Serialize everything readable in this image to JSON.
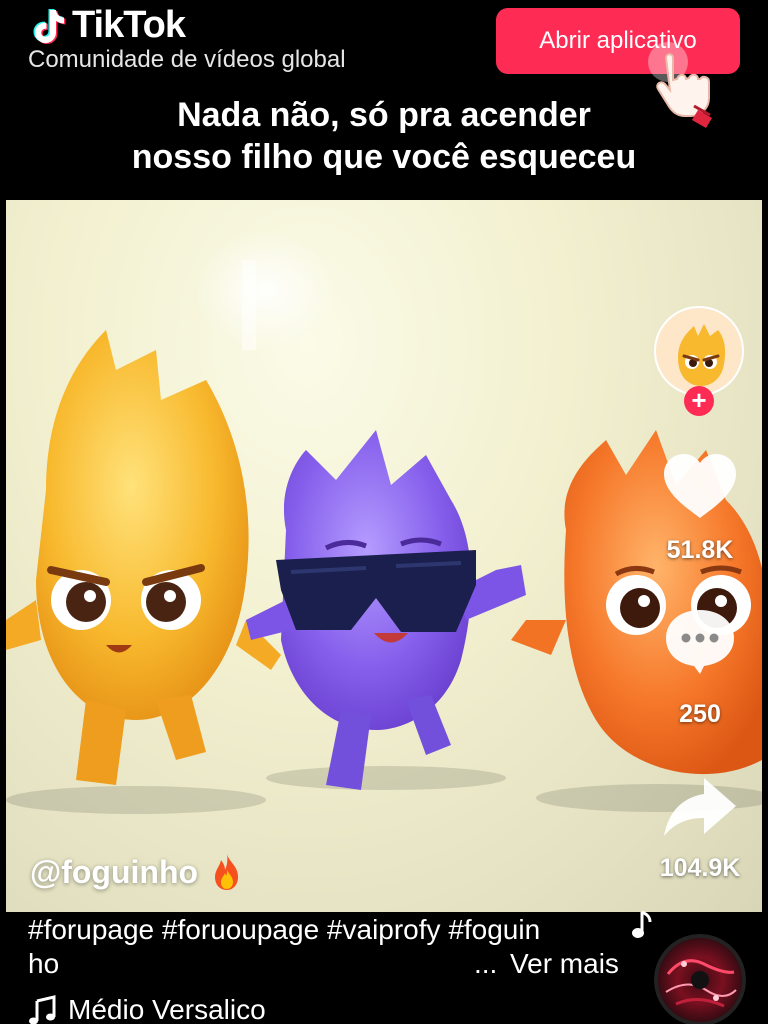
{
  "header": {
    "brand": "TikTok",
    "tagline": "Comunidade de vídeos global",
    "open_app_label": "Abrir aplicativo",
    "caption_line1": "Nada não, só pra acender",
    "caption_line2": "nosso filho que você esqueceu"
  },
  "rail": {
    "follow_symbol": "+",
    "likes": "51.8K",
    "comments": "250",
    "shares": "104.9K"
  },
  "post": {
    "username": "@foguinho",
    "description_line1": "#forupage #foruoupage #vaiprofy #foguin",
    "description_line2": "ho",
    "ellipsis": "...",
    "see_more": "Ver mais",
    "music": "Médio Versalico"
  },
  "colors": {
    "accent": "#fe2c55",
    "background": "#000000"
  },
  "icons": [
    "tiktok-logo-icon",
    "hand-pointer-icon",
    "heart-icon",
    "comment-icon",
    "share-icon",
    "fire-icon",
    "music-note-icon",
    "music-disc-icon"
  ]
}
